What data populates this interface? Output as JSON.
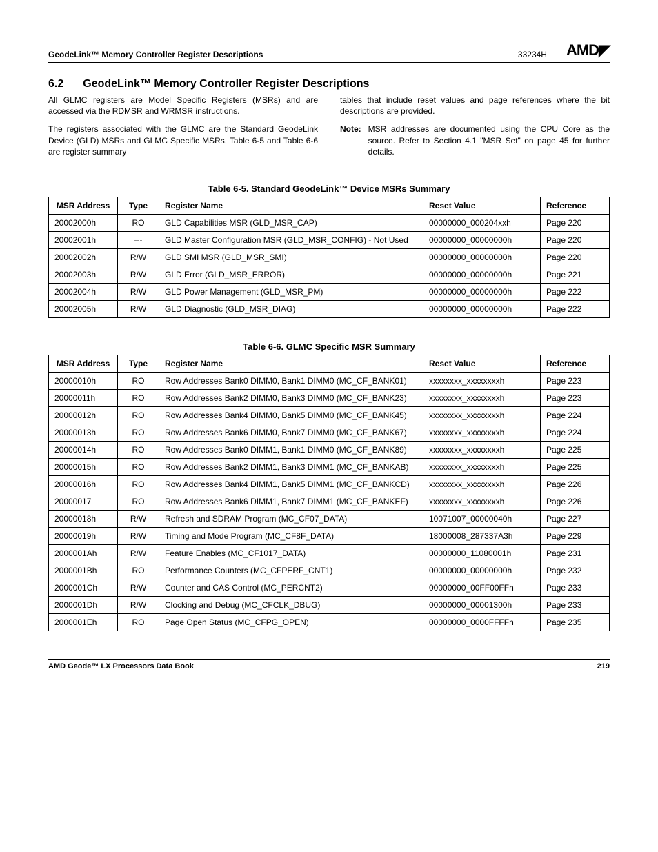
{
  "header": {
    "left": "GeodeLink™ Memory Controller Register Descriptions",
    "docnum": "33234H",
    "logo": "AMD◤"
  },
  "section": {
    "num": "6.2",
    "title": "GeodeLink™ Memory Controller Register Descriptions"
  },
  "intro": {
    "left_p1": "All GLMC registers are Model Specific Registers (MSRs) and are accessed via the RDMSR and WRMSR instructions.",
    "left_p2": "The registers associated with the GLMC are the Standard GeodeLink Device (GLD) MSRs and GLMC Specific MSRs. Table 6-5 and Table 6-6 are register summary",
    "right_p1": "tables that include reset values and page references where the bit descriptions are provided.",
    "note_label": "Note:",
    "note_body": "MSR addresses are documented using the CPU Core as the source. Refer to Section 4.1 \"MSR Set\" on page 45 for further details."
  },
  "table1": {
    "title": "Table 6-5.  Standard GeodeLink™ Device MSRs Summary",
    "headers": {
      "addr": "MSR Address",
      "type": "Type",
      "name": "Register Name",
      "reset": "Reset Value",
      "ref": "Reference"
    },
    "rows": [
      {
        "addr": "20002000h",
        "type": "RO",
        "name": "GLD Capabilities MSR (GLD_MSR_CAP)",
        "reset": "00000000_000204xxh",
        "ref": "Page 220"
      },
      {
        "addr": "20002001h",
        "type": "---",
        "name": "GLD Master Configuration MSR (GLD_MSR_CONFIG) - Not Used",
        "reset": "00000000_00000000h",
        "ref": "Page 220"
      },
      {
        "addr": "20002002h",
        "type": "R/W",
        "name": "GLD SMI MSR (GLD_MSR_SMI)",
        "reset": "00000000_00000000h",
        "ref": "Page 220"
      },
      {
        "addr": "20002003h",
        "type": "R/W",
        "name": "GLD Error (GLD_MSR_ERROR)",
        "reset": "00000000_00000000h",
        "ref": "Page 221"
      },
      {
        "addr": "20002004h",
        "type": "R/W",
        "name": "GLD Power Management (GLD_MSR_PM)",
        "reset": "00000000_00000000h",
        "ref": "Page 222"
      },
      {
        "addr": "20002005h",
        "type": "R/W",
        "name": "GLD Diagnostic (GLD_MSR_DIAG)",
        "reset": "00000000_00000000h",
        "ref": "Page 222"
      }
    ]
  },
  "table2": {
    "title": "Table 6-6.  GLMC Specific MSR Summary",
    "headers": {
      "addr": "MSR Address",
      "type": "Type",
      "name": "Register Name",
      "reset": "Reset Value",
      "ref": "Reference"
    },
    "rows": [
      {
        "addr": "20000010h",
        "type": "RO",
        "name": "Row Addresses Bank0 DIMM0, Bank1 DIMM0 (MC_CF_BANK01)",
        "reset": "xxxxxxxx_xxxxxxxxh",
        "ref": "Page 223"
      },
      {
        "addr": "20000011h",
        "type": "RO",
        "name": "Row Addresses Bank2 DIMM0, Bank3 DIMM0 (MC_CF_BANK23)",
        "reset": "xxxxxxxx_xxxxxxxxh",
        "ref": "Page 223"
      },
      {
        "addr": "20000012h",
        "type": "RO",
        "name": "Row Addresses Bank4 DIMM0, Bank5 DIMM0 (MC_CF_BANK45)",
        "reset": "xxxxxxxx_xxxxxxxxh",
        "ref": "Page 224"
      },
      {
        "addr": "20000013h",
        "type": "RO",
        "name": "Row Addresses Bank6 DIMM0, Bank7 DIMM0 (MC_CF_BANK67)",
        "reset": "xxxxxxxx_xxxxxxxxh",
        "ref": "Page 224"
      },
      {
        "addr": "20000014h",
        "type": "RO",
        "name": "Row Addresses Bank0 DIMM1, Bank1 DIMM0 (MC_CF_BANK89)",
        "reset": "xxxxxxxx_xxxxxxxxh",
        "ref": "Page 225"
      },
      {
        "addr": "20000015h",
        "type": "RO",
        "name": "Row Addresses Bank2 DIMM1, Bank3 DIMM1 (MC_CF_BANKAB)",
        "reset": "xxxxxxxx_xxxxxxxxh",
        "ref": "Page 225"
      },
      {
        "addr": "20000016h",
        "type": "RO",
        "name": "Row Addresses Bank4 DIMM1, Bank5 DIMM1 (MC_CF_BANKCD)",
        "reset": "xxxxxxxx_xxxxxxxxh",
        "ref": "Page 226"
      },
      {
        "addr": "20000017",
        "type": "RO",
        "name": "Row Addresses Bank6 DIMM1, Bank7 DIMM1 (MC_CF_BANKEF)",
        "reset": "xxxxxxxx_xxxxxxxxh",
        "ref": "Page 226"
      },
      {
        "addr": "20000018h",
        "type": "R/W",
        "name": "Refresh and SDRAM Program (MC_CF07_DATA)",
        "reset": "10071007_00000040h",
        "ref": "Page 227"
      },
      {
        "addr": "20000019h",
        "type": "R/W",
        "name": "Timing and Mode Program (MC_CF8F_DATA)",
        "reset": "18000008_287337A3h",
        "ref": "Page 229"
      },
      {
        "addr": "2000001Ah",
        "type": "R/W",
        "name": "Feature Enables (MC_CF1017_DATA)",
        "reset": "00000000_11080001h",
        "ref": "Page 231"
      },
      {
        "addr": "2000001Bh",
        "type": "RO",
        "name": "Performance Counters (MC_CFPERF_CNT1)",
        "reset": "00000000_00000000h",
        "ref": "Page 232"
      },
      {
        "addr": "2000001Ch",
        "type": "R/W",
        "name": "Counter and CAS Control (MC_PERCNT2)",
        "reset": "00000000_00FF00FFh",
        "ref": "Page 233"
      },
      {
        "addr": "2000001Dh",
        "type": "R/W",
        "name": "Clocking and Debug (MC_CFCLK_DBUG)",
        "reset": "00000000_00001300h",
        "ref": "Page 233"
      },
      {
        "addr": "2000001Eh",
        "type": "RO",
        "name": "Page Open Status (MC_CFPG_OPEN)",
        "reset": "00000000_0000FFFFh",
        "ref": "Page 235"
      }
    ]
  },
  "footer": {
    "book": "AMD Geode™ LX Processors Data Book",
    "page": "219"
  }
}
